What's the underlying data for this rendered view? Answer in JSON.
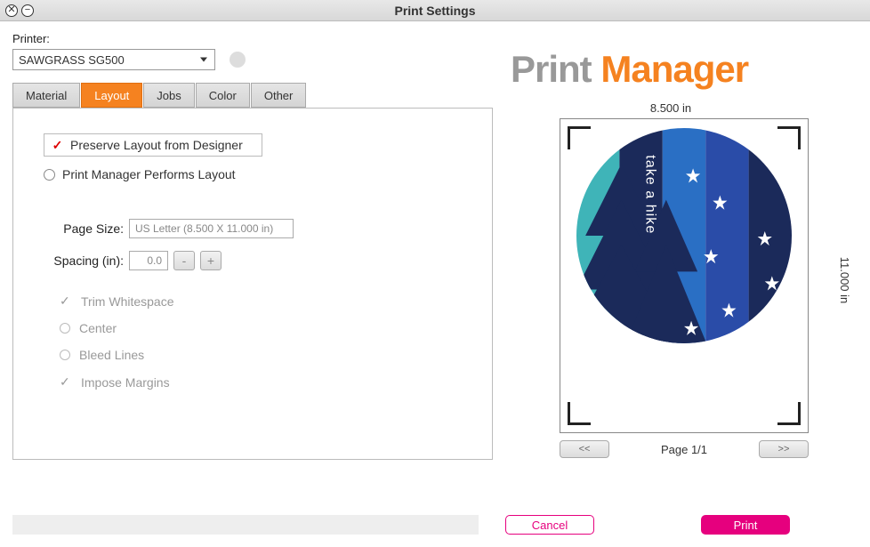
{
  "window": {
    "title": "Print Settings"
  },
  "printer": {
    "label": "Printer:",
    "selected": "SAWGRASS SG500"
  },
  "tabs": {
    "material": "Material",
    "layout": "Layout",
    "jobs": "Jobs",
    "color": "Color",
    "other": "Other"
  },
  "layout": {
    "preserve": "Preserve Layout from Designer",
    "pmperforms": "Print Manager Performs Layout",
    "page_size_label": "Page Size:",
    "page_size_value": "US Letter (8.500 X 11.000 in)",
    "spacing_label": "Spacing (in):",
    "spacing_value": "0.0",
    "minus": "-",
    "plus": "+",
    "options": {
      "trim": "Trim Whitespace",
      "center": "Center",
      "bleed": "Bleed Lines",
      "impose": "Impose Margins"
    }
  },
  "brand": {
    "word1": "Print ",
    "word2": "Manager"
  },
  "preview": {
    "width_label": "8.500 in",
    "height_label": "11.000 in",
    "artwork_text": "take a hike",
    "page_indicator": "Page 1/1",
    "prev": "<<",
    "next": ">>"
  },
  "actions": {
    "cancel": "Cancel",
    "print": "Print"
  }
}
